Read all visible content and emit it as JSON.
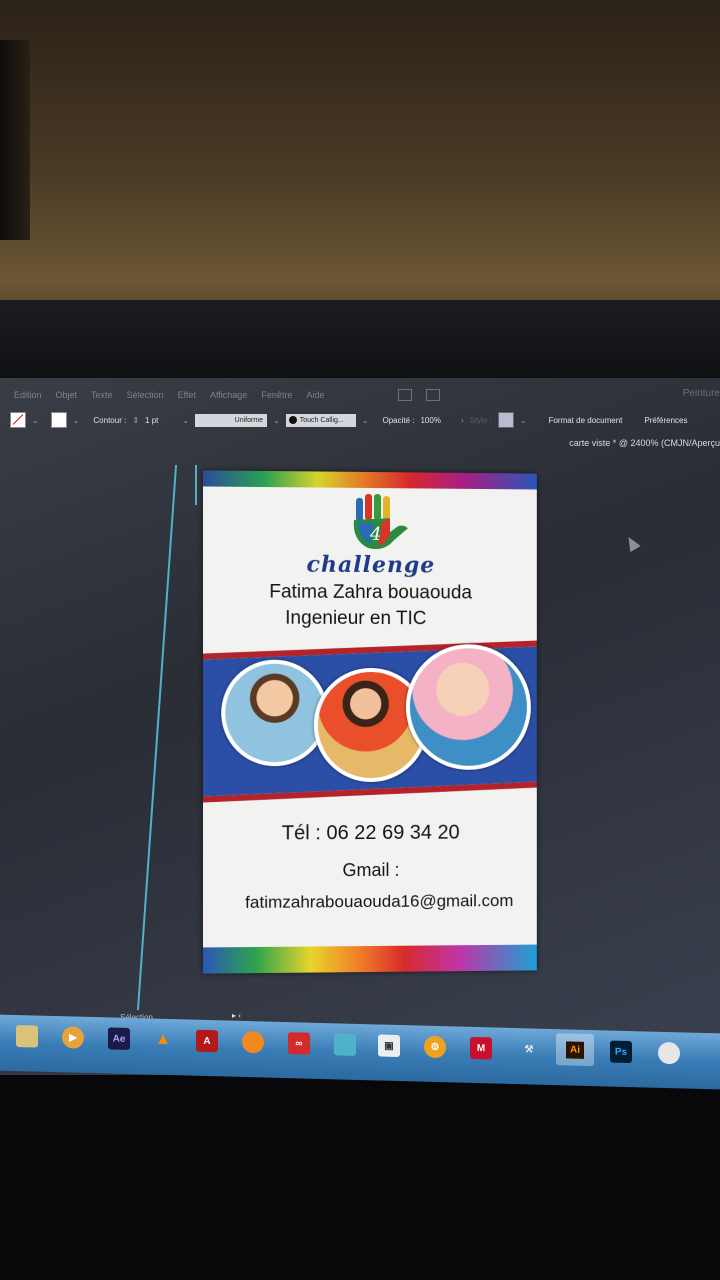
{
  "menu": {
    "items": [
      "Edition",
      "Objet",
      "Texte",
      "Sélection",
      "Effet",
      "Affichage",
      "Fenêtre",
      "Aide"
    ],
    "workspace": "Peinture"
  },
  "control_bar": {
    "contour_label": "Contour :",
    "stroke_width": "1 pt",
    "stroke_profile": "Uniforme",
    "brush": "Touch Callig...",
    "opacity_label": "Opacité :",
    "opacity_value": "100%",
    "style_label": "Style :",
    "document_format": "Format de document",
    "preferences": "Préférences"
  },
  "document_tab": "carte viste * @ 2400% (CMJN/Aperçu",
  "card": {
    "logo_text": "challenge",
    "logo_number": "4",
    "name": "Fatima Zahra bouaouda",
    "title": "Ingenieur  en TIC",
    "phone": "Tél : 06 22 69 34 20",
    "gmail_label": "Gmail :",
    "email": "fatimzahrabouaouda16@gmail.com",
    "colors": {
      "band_blue": "#2b4fa6",
      "band_red": "#b3232a",
      "logo_blue": "#1f3a8a"
    }
  },
  "status": {
    "tool": "Sélection"
  },
  "taskbar": {
    "icons": [
      {
        "name": "file-explorer-icon",
        "label": ""
      },
      {
        "name": "media-player-icon",
        "label": ""
      },
      {
        "name": "after-effects-icon",
        "label": "Ae"
      },
      {
        "name": "vlc-icon",
        "label": ""
      },
      {
        "name": "acrobat-icon",
        "label": ""
      },
      {
        "name": "avast-icon",
        "label": ""
      },
      {
        "name": "creative-cloud-icon",
        "label": ""
      },
      {
        "name": "app-icon",
        "label": ""
      },
      {
        "name": "app-icon-2",
        "label": ""
      },
      {
        "name": "settings-app-icon",
        "label": ""
      },
      {
        "name": "mcafee-icon",
        "label": "M"
      },
      {
        "name": "tool-icon",
        "label": ""
      },
      {
        "name": "illustrator-icon",
        "label": "Ai"
      },
      {
        "name": "photoshop-icon",
        "label": "Ps"
      },
      {
        "name": "app-icon-3",
        "label": ""
      }
    ]
  }
}
